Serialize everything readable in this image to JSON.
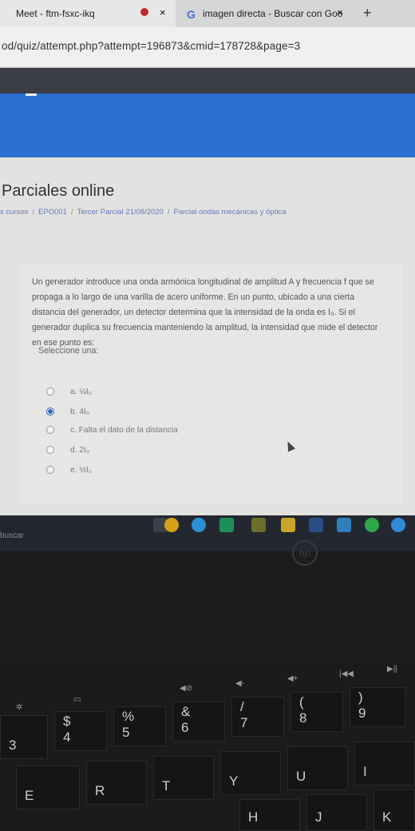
{
  "browser": {
    "tabs": [
      {
        "label": "Meet - ftm-fsxc-ikq",
        "close": "×"
      },
      {
        "label": "imagen directa - Buscar con Goo",
        "close": "×"
      }
    ],
    "new_tab": "+",
    "url": "od/quiz/attempt.php?attempt=196873&cmid=178728&page=3"
  },
  "page": {
    "title": "Parciales online",
    "breadcrumbs": [
      "s cursos",
      "EPO001",
      "Tercer Parcial 21/08/2020",
      "Parcial ondas mecánicas y óptica"
    ],
    "breadcrumb_sep": "/"
  },
  "question": {
    "text": "Un generador introduce una onda armónica longitudinal de amplitud A y frecuencia f que se propaga a lo largo de una varilla de acero uniforme. En un punto, ubicado a una cierta distancia del generador, un detector determina que la intensidad de la onda es I₀. Si el generador duplica su frecuencia manteniendo la amplitud, la intensidad que mide el detector en ese punto es:",
    "prompt": "Seleccione una:",
    "options": [
      {
        "label": "a. ¼I₀",
        "selected": false
      },
      {
        "label": "b. 4I₀",
        "selected": true
      },
      {
        "label": "c. Falta el dato de la distancia",
        "selected": false
      },
      {
        "label": "d. 2I₀",
        "selected": false
      },
      {
        "label": "e. ½I₀",
        "selected": false
      }
    ]
  },
  "taskbar": {
    "search_text": "buscar"
  },
  "laptop": {
    "logo": "hp",
    "keys": [
      "3",
      "$\n4",
      "%\n5",
      "&\n6",
      "/\n7",
      "(\n8",
      ")\n9",
      "E",
      "R",
      "T",
      "Y",
      "U",
      "I",
      "J",
      "K",
      "H"
    ]
  },
  "colors": {
    "accent_blue": "#2c6fd0",
    "header_dark": "#3a3d44",
    "link": "#6a78b8"
  }
}
